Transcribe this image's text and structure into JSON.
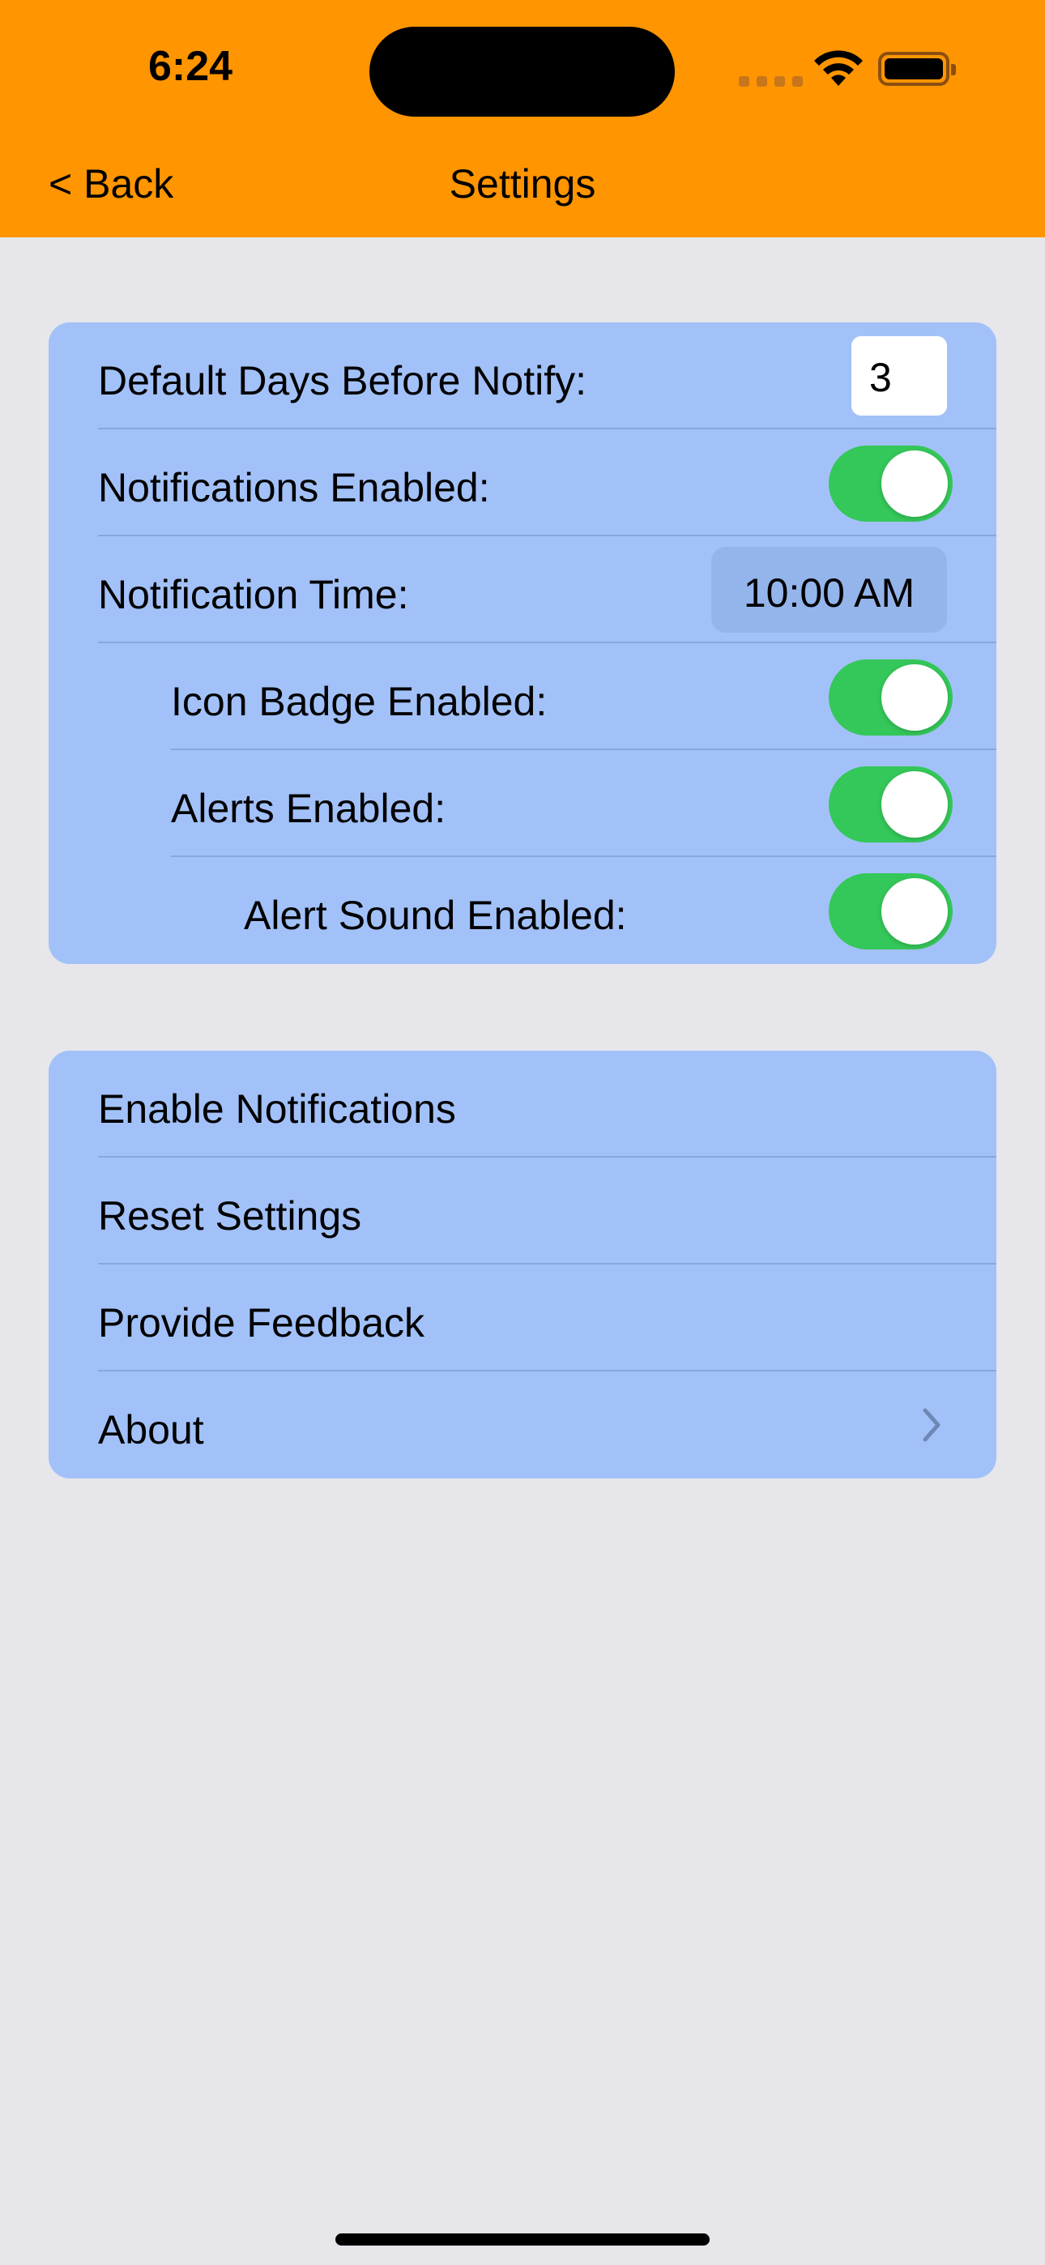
{
  "status_bar": {
    "time": "6:24",
    "icons": [
      "cellular-signal-icon",
      "wifi-icon",
      "battery-icon"
    ]
  },
  "nav": {
    "back_label": "< Back",
    "title": "Settings"
  },
  "settings_group": {
    "default_days_label": "Default Days Before Notify:",
    "default_days_value": "3",
    "notifications_enabled_label": "Notifications Enabled:",
    "notifications_enabled": true,
    "notification_time_label": "Notification Time:",
    "notification_time_value": "10:00 AM",
    "icon_badge_label": "Icon Badge Enabled:",
    "icon_badge_enabled": true,
    "alerts_label": "Alerts Enabled:",
    "alerts_enabled": true,
    "alert_sound_label": "Alert Sound Enabled:",
    "alert_sound_enabled": true
  },
  "actions_group": {
    "enable_notifications": "Enable Notifications",
    "reset_settings": "Reset Settings",
    "provide_feedback": "Provide Feedback",
    "about": "About"
  },
  "colors": {
    "header": "#ff9500",
    "background": "#e6e6eb",
    "group": "#a2c1f9",
    "toggle_on": "#34c759"
  }
}
